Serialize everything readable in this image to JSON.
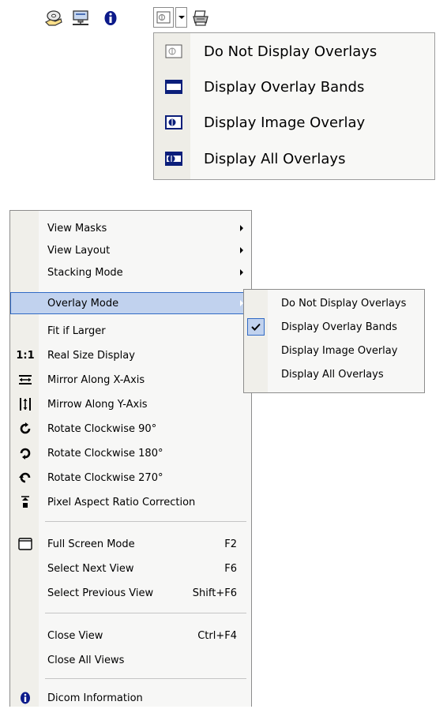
{
  "toolbar": {
    "buttons": [
      {
        "icon": "hand-disk-icon"
      },
      {
        "icon": "network-screen-icon"
      },
      {
        "icon": "info-icon"
      },
      {
        "icon": "overlay-mode-icon"
      },
      {
        "icon": "dropdown-arrow-icon"
      },
      {
        "icon": "printer-icon"
      }
    ]
  },
  "overlay_dropdown": {
    "items": [
      {
        "label": "Do Not Display Overlays",
        "icon": "no-overlay-icon"
      },
      {
        "label": "Display Overlay Bands",
        "icon": "overlay-bands-icon"
      },
      {
        "label": "Display Image Overlay",
        "icon": "image-overlay-icon"
      },
      {
        "label": "Display All Overlays",
        "icon": "all-overlays-icon"
      }
    ]
  },
  "context_menu": {
    "items": [
      {
        "label": "View Masks",
        "submenu": true
      },
      {
        "label": "View Layout",
        "submenu": true
      },
      {
        "label": "Stacking Mode",
        "submenu": true
      },
      {
        "label": "Overlay Mode",
        "submenu": true,
        "highlighted": true
      },
      {
        "label": "Fit if Larger"
      },
      {
        "label": "Real Size Display",
        "icon_text": "1:1"
      },
      {
        "label": "Mirror Along X-Axis",
        "icon": "mirror-x-icon"
      },
      {
        "label": "Mirrow Along Y-Axis",
        "icon": "mirror-y-icon"
      },
      {
        "label": "Rotate Clockwise 90°",
        "icon": "rotate-90-icon"
      },
      {
        "label": "Rotate Clockwise 180°",
        "icon": "rotate-180-icon"
      },
      {
        "label": "Rotate Clockwise 270°",
        "icon": "rotate-270-icon"
      },
      {
        "label": "Pixel Aspect Ratio Correction",
        "icon": "aspect-ratio-icon"
      },
      {
        "label": "Full Screen Mode",
        "shortcut": "F2",
        "icon": "full-screen-icon"
      },
      {
        "label": "Select Next View",
        "shortcut": "F6"
      },
      {
        "label": "Select Previous View",
        "shortcut": "Shift+F6"
      },
      {
        "label": "Close View",
        "shortcut": "Ctrl+F4"
      },
      {
        "label": "Close All Views"
      },
      {
        "label": "Dicom Information",
        "icon": "info-icon"
      }
    ]
  },
  "overlay_submenu": {
    "items": [
      {
        "label": "Do Not Display Overlays",
        "checked": false
      },
      {
        "label": "Display Overlay Bands",
        "checked": true
      },
      {
        "label": "Display Image Overlay",
        "checked": false
      },
      {
        "label": "Display All Overlays",
        "checked": false
      }
    ]
  },
  "colors": {
    "highlight": "#c1d2ee",
    "highlight_border": "#316ac5",
    "menu_bg": "#f7f7f6",
    "gutter_bg": "#f0efea"
  }
}
